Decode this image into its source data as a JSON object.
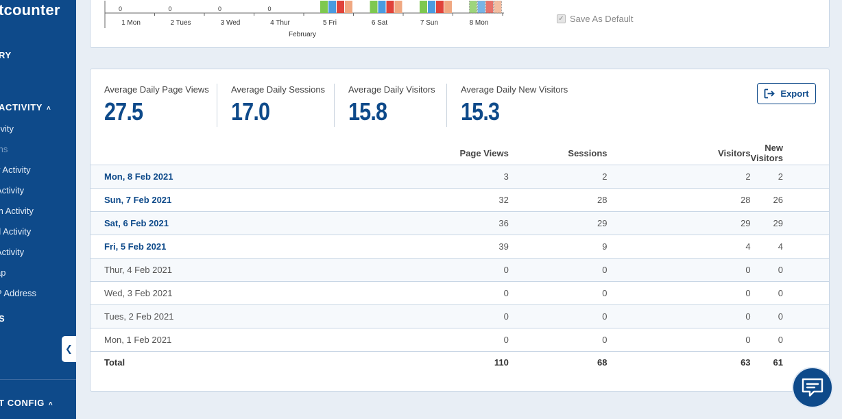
{
  "sidebar": {
    "brand": "tcounter",
    "section_summary": "RY",
    "section_activity": "ACTIVITY",
    "items": [
      {
        "label": "tivity",
        "dim": false
      },
      {
        "label": "ths",
        "dim": true
      },
      {
        "label": "v Activity",
        "dim": false
      },
      {
        "label": "Activity",
        "dim": false
      },
      {
        "label": "m Activity",
        "dim": false
      },
      {
        "label": "d Activity",
        "dim": false
      },
      {
        "label": "Activity",
        "dim": false
      },
      {
        "label": "ap",
        "dim": false
      },
      {
        "label": "P Address",
        "dim": false
      }
    ],
    "section_s": "S",
    "section_config": "T CONFIG"
  },
  "chart": {
    "x_labels": [
      "1 Mon",
      "2 Tues",
      "3 Wed",
      "4 Thur",
      "5 Fri",
      "6 Sat",
      "7 Sun",
      "8 Mon"
    ],
    "zero_label": "0",
    "month_label": "February",
    "save_default_label": "Save As Default",
    "colors": {
      "green": "#7ec850",
      "blue": "#4a9be0",
      "red": "#e0433a",
      "salmon": "#f0a882"
    }
  },
  "stats": [
    {
      "label": "Average Daily Page Views",
      "value": "27.5"
    },
    {
      "label": "Average Daily Sessions",
      "value": "17.0"
    },
    {
      "label": "Average Daily Visitors",
      "value": "15.8"
    },
    {
      "label": "Average Daily New Visitors",
      "value": "15.3"
    }
  ],
  "export_label": "Export",
  "table": {
    "headers": [
      "",
      "Page Views",
      "Sessions",
      "Visitors",
      "New Visitors"
    ],
    "rows": [
      {
        "date": "Mon, 8 Feb 2021",
        "page_views": "3",
        "sessions": "2",
        "visitors": "2",
        "new_visitors": "2"
      },
      {
        "date": "Sun, 7 Feb 2021",
        "page_views": "32",
        "sessions": "28",
        "visitors": "28",
        "new_visitors": "26"
      },
      {
        "date": "Sat, 6 Feb 2021",
        "page_views": "36",
        "sessions": "29",
        "visitors": "29",
        "new_visitors": "29"
      },
      {
        "date": "Fri, 5 Feb 2021",
        "page_views": "39",
        "sessions": "9",
        "visitors": "4",
        "new_visitors": "4"
      },
      {
        "date": "Thur, 4 Feb 2021",
        "page_views": "0",
        "sessions": "0",
        "visitors": "0",
        "new_visitors": "0"
      },
      {
        "date": "Wed, 3 Feb 2021",
        "page_views": "0",
        "sessions": "0",
        "visitors": "0",
        "new_visitors": "0"
      },
      {
        "date": "Tues, 2 Feb 2021",
        "page_views": "0",
        "sessions": "0",
        "visitors": "0",
        "new_visitors": "0"
      },
      {
        "date": "Mon, 1 Feb 2021",
        "page_views": "0",
        "sessions": "0",
        "visitors": "0",
        "new_visitors": "0"
      }
    ],
    "total": {
      "label": "Total",
      "page_views": "110",
      "sessions": "68",
      "visitors": "63",
      "new_visitors": "61"
    }
  }
}
